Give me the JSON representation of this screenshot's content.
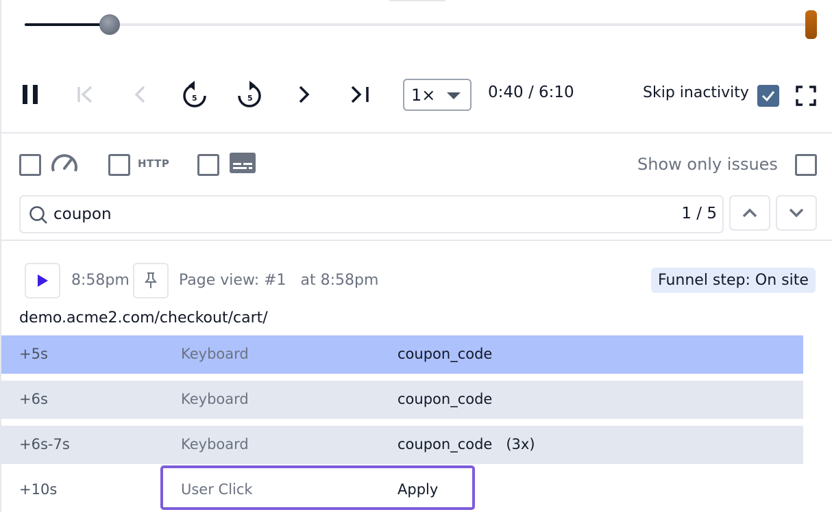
{
  "player": {
    "progress": 0.108,
    "speed": "1×",
    "current_time": "0:40",
    "separator": "/",
    "total_time": "6:10",
    "skip_inactivity_label": "Skip inactivity",
    "skip_inactivity_checked": true,
    "rewind_seconds": "5",
    "forward_seconds": "5",
    "icons": [
      "pause-icon",
      "skip-to-start-icon",
      "previous-icon",
      "rewind-5-icon",
      "forward-5-icon",
      "next-icon",
      "skip-to-end-icon",
      "fullscreen-icon"
    ]
  },
  "filters": {
    "http_label": "HTTP",
    "show_only_issues_label": "Show only issues",
    "show_only_issues_checked": false,
    "icons": [
      "speedometer-icon",
      "subtitles-icon"
    ]
  },
  "search": {
    "query": "coupon",
    "match_count": "1 / 5"
  },
  "page_view": {
    "time": "8:58pm",
    "label": "Page view: #1   at 8:58pm",
    "funnel_step": "Funnel step: On site",
    "url": "demo.acme2.com/checkout/cart/"
  },
  "events": [
    {
      "offset": "+5s",
      "type": "Keyboard",
      "target": "coupon_code",
      "state": "active"
    },
    {
      "offset": "+6s",
      "type": "Keyboard",
      "target": "coupon_code",
      "state": "match"
    },
    {
      "offset": "+6s-7s",
      "type": "Keyboard",
      "target": "coupon_code   (3x)",
      "state": "match"
    },
    {
      "offset": "+10s",
      "type": "User Click",
      "target": "Apply",
      "state": "outlined"
    }
  ],
  "colors": {
    "active_row": "#adc1fc",
    "match_row": "#e3e8f0",
    "outline": "#7c5cdb",
    "end_marker": "#b0600b",
    "checkbox_checked": "#4b6a8f",
    "play_icon": "#3b1ee0",
    "funnel_bg": "#e4ecfb"
  }
}
